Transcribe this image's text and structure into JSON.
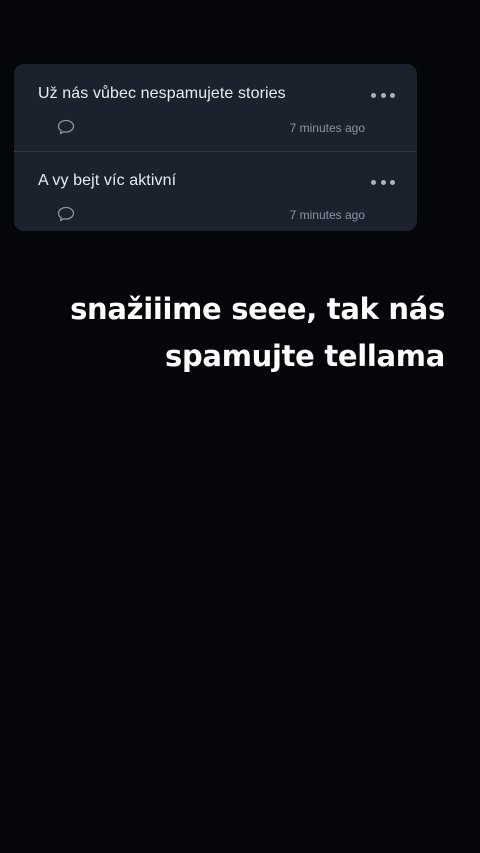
{
  "messages": [
    {
      "text": "Už nás vůbec nespamujete stories",
      "time": "7 minutes ago",
      "more_icon": "more-horizontal-icon",
      "reply_icon": "speech-bubble-icon"
    },
    {
      "text": "A vy bejt víc aktivní",
      "time": "7 minutes ago",
      "more_icon": "more-horizontal-icon",
      "reply_icon": "speech-bubble-icon"
    }
  ],
  "caption": {
    "line1": "snažiiime seee, tak nás",
    "line2": "spamujte tellama"
  },
  "colors": {
    "background": "#050609",
    "card": "#1b222d",
    "divider": "#2e3744",
    "text": "#e9ecf1",
    "muted": "#8b94a2",
    "caption": "#ffffff"
  }
}
